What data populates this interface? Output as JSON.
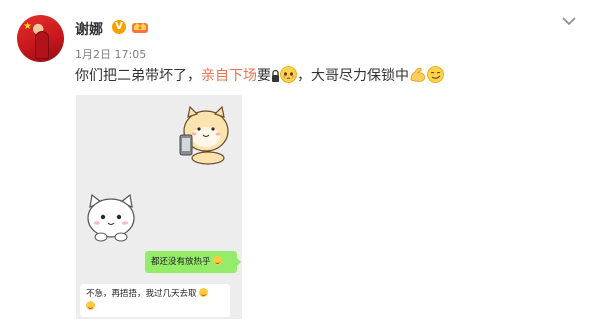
{
  "post": {
    "username": "谢娜",
    "vip_badge": "V",
    "timestamp": "1月2日 17:05",
    "text": {
      "part1": "你们把二弟带坏了，",
      "highlight": "亲自下场",
      "part2": "要",
      "part3": "，大哥尽力保锁中"
    }
  },
  "chat": {
    "bubble_right": "都还没有放热乎",
    "bubble_left": "不急，再捂捂，我过几天去取"
  },
  "icons": {
    "menu": "chevron-down-icon",
    "vip": "vip-badge-icon",
    "crown": "crown-icon",
    "lock": "lock-icon",
    "emoji_shy": "shy-face-emoji",
    "emoji_muscle": "muscle-emoji",
    "emoji_smirk": "smirk-face-emoji"
  },
  "colors": {
    "highlight": "#eb7350",
    "chat_bubble_green": "#95ec69",
    "chat_background": "#ededed",
    "vip_orange": "#f7a100"
  }
}
